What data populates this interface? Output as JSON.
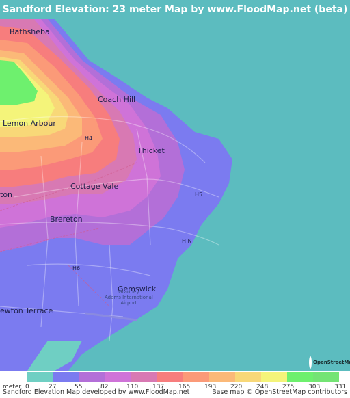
{
  "title": "Sandford Elevation: 23 meter Map by www.FloodMap.net (beta)",
  "colors": {
    "sea": "#5cbcbf",
    "title_bar": "#5cbcbf"
  },
  "places": {
    "bathsheba": "Bathsheba",
    "coach_hill": "Coach Hill",
    "lemon_arbour": "Lemon Arbour",
    "thicket": "Thicket",
    "cottage_vale": "Cottage Vale",
    "brereton": "Brereton",
    "gemswick": "Gemswick",
    "newton_terrace": "ewton Terrace",
    "ton_fragment": "ton",
    "airport": "Grantley\nAdams International\nAirport"
  },
  "roads": {
    "h4": "H4",
    "h5": "H5",
    "h6": "H6",
    "hn": "H N"
  },
  "legend": {
    "unit_label": "meter",
    "values": [
      "0",
      "27",
      "55",
      "82",
      "110",
      "137",
      "165",
      "193",
      "220",
      "248",
      "275",
      "303",
      "331"
    ],
    "colors": [
      "#6fcfc3",
      "#7b7bf0",
      "#b36fd8",
      "#cf73d8",
      "#d879b3",
      "#f77d7d",
      "#fb9a78",
      "#fbb978",
      "#f8d878",
      "#f4f47a",
      "#6ef06e",
      "#74e474"
    ]
  },
  "footer": {
    "left": "Sandford Elevation Map developed by www.FloodMap.net",
    "right": "Base map © OpenStreetMap contributors"
  },
  "osm_logo_text": "OpenStreetMap"
}
